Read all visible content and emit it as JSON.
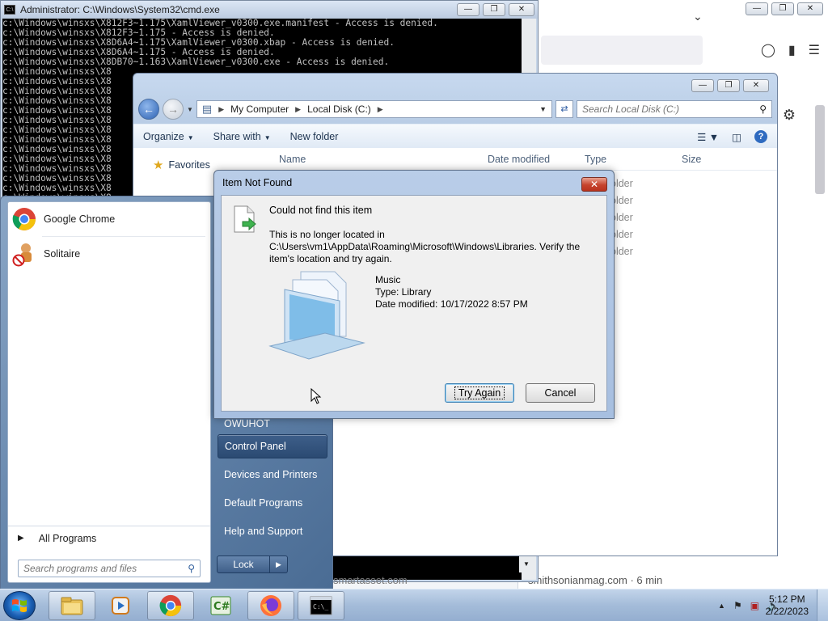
{
  "cmd": {
    "title": "Administrator: C:\\Windows\\System32\\cmd.exe",
    "icon": "cmd-icon",
    "lines": [
      "c:\\Windows\\winsxs\\X812F3~1.175\\XamlViewer_v0300.exe.manifest - Access is denied.",
      "",
      "c:\\Windows\\winsxs\\X812F3~1.175 - Access is denied.",
      "c:\\Windows\\winsxs\\X8D6A4~1.175\\XamlViewer_v0300.xbap - Access is denied.",
      "c:\\Windows\\winsxs\\X8D6A4~1.175 - Access is denied.",
      "c:\\Windows\\winsxs\\X8DB70~1.163\\XamlViewer_v0300.exe - Access is denied.",
      "c:\\Windows\\winsxs\\X8",
      "c:\\Windows\\winsxs\\X8",
      "c:\\Windows\\winsxs\\X8",
      "c:\\Windows\\winsxs\\X8",
      "c:\\Windows\\winsxs\\X8",
      "c:\\Windows\\winsxs\\X8",
      "c:\\Windows\\winsxs\\X8",
      "c:\\Windows\\winsxs\\X8",
      "c:\\Windows\\winsxs\\X8",
      "c:\\Windows\\winsxs\\X8",
      "c:\\Windows\\winsxs\\X8",
      "c:\\Windows\\winsxs\\X8",
      "c:\\Windows\\winsxs\\X8",
      "c:\\Windows\\winsxs\\X8"
    ]
  },
  "browser": {
    "feed_text": "smithsonianmag.com · 6 min",
    "feed_text_left": "smartasset.com"
  },
  "explorer": {
    "breadcrumb": [
      "My Computer",
      "Local Disk (C:)"
    ],
    "search_placeholder": "Search Local Disk (C:)",
    "toolbar": {
      "organize": "Organize",
      "share_with": "Share with",
      "new_folder": "New folder"
    },
    "columns": [
      "Name",
      "Date modified",
      "Type",
      "Size"
    ],
    "rows": [
      "older",
      "older",
      "older",
      "older",
      "older"
    ],
    "nav": {
      "favorites": "Favorites"
    }
  },
  "start_menu": {
    "programs": [
      {
        "label": "Google Chrome",
        "icon": "chrome-icon"
      },
      {
        "label": "Solitaire",
        "icon": "solitaire-icon"
      }
    ],
    "all_programs": "All Programs",
    "search_placeholder": "Search programs and files",
    "right_items": {
      "user": "OWUHOT",
      "control_panel": "Control Panel",
      "devices_printers": "Devices and Printers",
      "default_programs": "Default Programs",
      "help_support": "Help and Support"
    },
    "lock_label": "Lock"
  },
  "dialog": {
    "title": "Item Not Found",
    "heading": "Could not find this item",
    "message": "This is no longer located in C:\\Users\\vm1\\AppData\\Roaming\\Microsoft\\Windows\\Libraries. Verify the item's location and try again.",
    "item_name": "Music",
    "item_type": "Type: Library",
    "item_date": "Date modified: 10/17/2022 8:57 PM",
    "try_again": "Try Again",
    "cancel": "Cancel"
  },
  "taskbar": {
    "apps": [
      "explorer-icon",
      "media-player-icon",
      "chrome-icon",
      "csharp-icon",
      "firefox-icon",
      "cmd-icon"
    ],
    "time": "5:12 PM",
    "date": "2/22/2023"
  },
  "colors": {
    "dialog_close": "#c6432e",
    "start_panel": "#5e7fa6",
    "taskbar": "#a4bcd9"
  }
}
